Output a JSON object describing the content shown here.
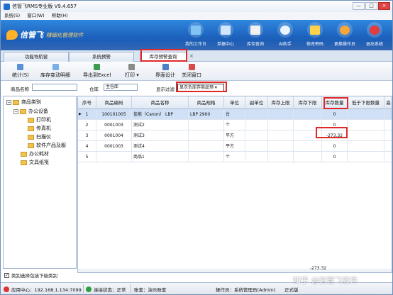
{
  "window": {
    "title": "信管飞RMS专业版 V9.4.657",
    "controls": [
      "—",
      "□",
      "×"
    ]
  },
  "menu": [
    "系统(S)",
    "窗口(W)",
    "帮助(H)"
  ],
  "brand": {
    "logo": "信管飞",
    "slogan": "精细化管理软件"
  },
  "tools": [
    {
      "label": "我的工作台",
      "icon": "monitor-icon",
      "color": "#7fc4f5"
    },
    {
      "label": "单据中心",
      "icon": "documents-icon",
      "color": "#cfe6fb"
    },
    {
      "label": "库存查询",
      "icon": "warehouse-icon",
      "color": "#f2f2f2"
    },
    {
      "label": "AI助手",
      "icon": "ai-assistant-icon",
      "color": "#e9f3fc"
    },
    {
      "label": "修改密码",
      "icon": "key-icon",
      "color": "#ffd24a"
    },
    {
      "label": "更换操作员",
      "icon": "user-icon",
      "color": "#f7a637"
    },
    {
      "label": "退出系统",
      "icon": "exit-icon",
      "color": "#e43b3b"
    }
  ],
  "tabs": [
    "功能导航窗",
    "系统预警",
    "库存预警查询"
  ],
  "toolbar": [
    "统计(S)",
    "库存变动明细",
    "导出到Excel",
    "打印 ▾",
    "界面设计",
    "关闭窗口"
  ],
  "filters": {
    "name_label": "商品名称",
    "name_value": "",
    "warehouse_label": "仓库",
    "warehouse_value": "主仓库",
    "display_label": "显示过滤",
    "display_value": "显示负库存商品预 ▾"
  },
  "tree": {
    "root": "商品类别",
    "nodes": [
      "办公设备",
      "打印机",
      "传真机",
      "扫描仪",
      "软件产品及服",
      "办公耗材",
      "文具纸笺"
    ],
    "include_sub_label": "类别选择包括下级类别",
    "include_sub_checked": "✓"
  },
  "grid": {
    "columns": [
      "序号",
      "商品编码",
      "商品名称",
      "商品规格",
      "单位",
      "副单位",
      "库存上限",
      "库存下限",
      "库存数量",
      "低于下限数量",
      "高"
    ],
    "rows": [
      [
        "1",
        "100101005",
        "佳能（Canon）  LBP",
        "LBP 2900",
        "台",
        "",
        "",
        "",
        "0",
        "",
        ""
      ],
      [
        "2",
        "0001003",
        "测试2",
        "",
        "个",
        "",
        "",
        "",
        "0",
        "",
        ""
      ],
      [
        "3",
        "0001004",
        "测试3",
        "",
        "平方",
        "",
        "",
        "",
        "-273.32",
        "",
        ""
      ],
      [
        "4",
        "0001003",
        "测试4",
        "",
        "平方",
        "",
        "",
        "",
        "0",
        "",
        ""
      ],
      [
        "5",
        "",
        "商品1",
        "",
        "个",
        "",
        "",
        "",
        "0",
        "",
        ""
      ]
    ],
    "total": "-273.32"
  },
  "status": {
    "server": "应用中心：192.168.1.134:7099",
    "connection": "连接状态：正常",
    "account": "账套：演示账套",
    "operator": "操作员：系统管理员(Admin)",
    "edition": "正式版"
  },
  "watermark": "知乎 @信管飞软件"
}
